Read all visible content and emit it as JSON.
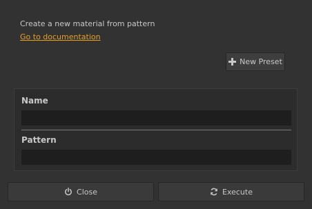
{
  "header": {
    "description": "Create a new material from pattern",
    "doc_link": "Go to documentation"
  },
  "toolbar": {
    "new_preset_label": "New Preset",
    "new_preset_icon": "plus-icon"
  },
  "form": {
    "name_label": "Name",
    "name_value": "",
    "pattern_label": "Pattern",
    "pattern_value": ""
  },
  "footer": {
    "close_label": "Close",
    "close_icon": "power-icon",
    "execute_label": "Execute",
    "execute_icon": "refresh-icon"
  },
  "colors": {
    "background": "#323232",
    "link": "#e8a020",
    "input_background": "#1e1e1e"
  }
}
